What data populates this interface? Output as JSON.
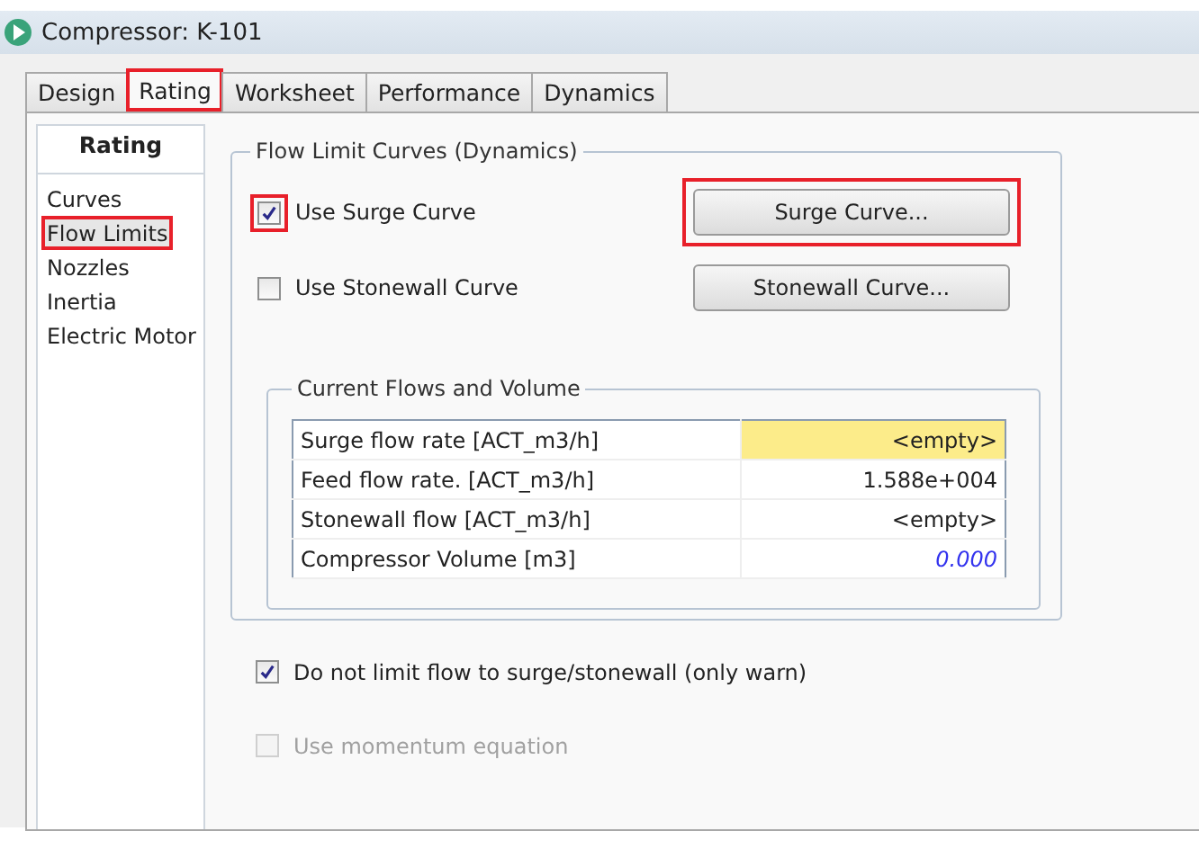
{
  "window": {
    "title": "Compressor: K-101"
  },
  "tabs": [
    {
      "label": "Design",
      "selected": false,
      "highlighted": false
    },
    {
      "label": "Rating",
      "selected": true,
      "highlighted": true
    },
    {
      "label": "Worksheet",
      "selected": false,
      "highlighted": false
    },
    {
      "label": "Performance",
      "selected": false,
      "highlighted": false
    },
    {
      "label": "Dynamics",
      "selected": false,
      "highlighted": false
    }
  ],
  "sidebar": {
    "title": "Rating",
    "items": [
      {
        "label": "Curves",
        "selected": false,
        "highlighted": false
      },
      {
        "label": "Flow Limits",
        "selected": true,
        "highlighted": true
      },
      {
        "label": "Nozzles",
        "selected": false,
        "highlighted": false
      },
      {
        "label": "Inertia",
        "selected": false,
        "highlighted": false
      },
      {
        "label": "Electric Motor",
        "selected": false,
        "highlighted": false
      }
    ]
  },
  "flow_limit_curves": {
    "title": "Flow Limit Curves (Dynamics)",
    "rows": [
      {
        "checkbox": {
          "label": "Use Surge Curve",
          "checked": true,
          "highlighted": true
        },
        "button": {
          "label": "Surge Curve...",
          "highlighted": true
        }
      },
      {
        "checkbox": {
          "label": "Use Stonewall Curve",
          "checked": false,
          "highlighted": false
        },
        "button": {
          "label": "Stonewall Curve...",
          "highlighted": false
        }
      }
    ],
    "current_flows": {
      "title": "Current Flows and Volume",
      "rows": [
        {
          "label": "Surge flow rate [ACT_m3/h]",
          "value": "<empty>",
          "selected": true,
          "kind": "plain"
        },
        {
          "label": "Feed flow rate. [ACT_m3/h]",
          "value": "1.588e+004",
          "selected": false,
          "kind": "plain"
        },
        {
          "label": "Stonewall flow [ACT_m3/h]",
          "value": "<empty>",
          "selected": false,
          "kind": "plain"
        },
        {
          "label": "Compressor Volume [m3]",
          "value": "0.000",
          "selected": false,
          "kind": "default"
        }
      ]
    }
  },
  "options": [
    {
      "label": "Do not limit flow to surge/stonewall (only warn)",
      "checked": true,
      "disabled": false
    },
    {
      "label": "Use momentum equation",
      "checked": false,
      "disabled": true
    }
  ]
}
